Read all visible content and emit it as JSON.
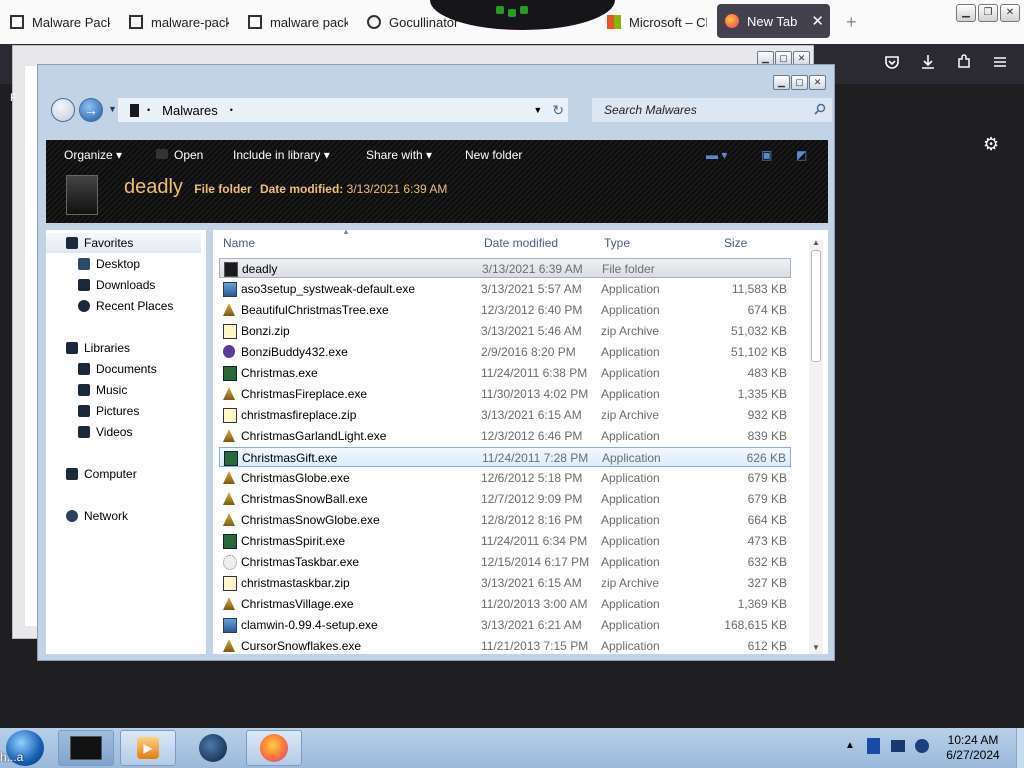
{
  "browser": {
    "tabs": [
      {
        "label": "Malware Pack",
        "favicon": "page-icon"
      },
      {
        "label": "malware-pack",
        "favicon": "page-icon"
      },
      {
        "label": "malware pack",
        "favicon": "page-icon"
      },
      {
        "label": "Gocullinator",
        "favicon": "github-icon"
      },
      {
        "label": "Microsoft – Cl",
        "favicon": "microsoft-icon"
      }
    ],
    "active_tab": {
      "label": "New Tab",
      "close": "✕"
    },
    "new_tab": "+",
    "toolbar_icons": [
      "pocket-icon",
      "download-icon",
      "extensions-icon",
      "menu-icon"
    ],
    "bg_window_letter": "F"
  },
  "explorer": {
    "nav_back": "◀",
    "nav_forward": "→",
    "address": "Malwares",
    "search_placeholder": "Search Malwares",
    "toolbar": {
      "organize": "Organize",
      "open": "Open",
      "include": "Include in library",
      "share": "Share with",
      "new_folder": "New folder"
    },
    "details": {
      "name": "deadly",
      "type": "File folder",
      "modified_label": "Date modified:",
      "modified_value": "3/13/2021 6:39 AM"
    },
    "nav": {
      "favorites": "Favorites",
      "desktop": "Desktop",
      "downloads": "Downloads",
      "recent": "Recent Places",
      "libraries": "Libraries",
      "documents": "Documents",
      "music": "Music",
      "pictures": "Pictures",
      "videos": "Videos",
      "computer": "Computer",
      "network": "Network"
    },
    "columns": {
      "name": "Name",
      "date": "Date modified",
      "type": "Type",
      "size": "Size"
    },
    "files": [
      {
        "name": "deadly",
        "date": "3/13/2021 6:39 AM",
        "type": "File folder",
        "size": "",
        "icon": "folder-icon"
      },
      {
        "name": "aso3setup_systweak-default.exe",
        "date": "3/13/2021 5:57 AM",
        "type": "Application",
        "size": "11,583 KB",
        "icon": "installer-icon"
      },
      {
        "name": "BeautifulChristmasTree.exe",
        "date": "12/3/2012 6:40 PM",
        "type": "Application",
        "size": "674 KB",
        "icon": "tree-icon"
      },
      {
        "name": "Bonzi.zip",
        "date": "3/13/2021 5:46 AM",
        "type": "zip Archive",
        "size": "51,032 KB",
        "icon": "zip-icon"
      },
      {
        "name": "BonziBuddy432.exe",
        "date": "2/9/2016 8:20 PM",
        "type": "Application",
        "size": "51,102 KB",
        "icon": "bonzi-icon"
      },
      {
        "name": "Christmas.exe",
        "date": "11/24/2011 6:38 PM",
        "type": "Application",
        "size": "483 KB",
        "icon": "christmas-icon"
      },
      {
        "name": "ChristmasFireplace.exe",
        "date": "11/30/2013 4:02 PM",
        "type": "Application",
        "size": "1,335 KB",
        "icon": "tree-icon"
      },
      {
        "name": "christmasfireplace.zip",
        "date": "3/13/2021 6:15 AM",
        "type": "zip Archive",
        "size": "932 KB",
        "icon": "zip-icon"
      },
      {
        "name": "ChristmasGarlandLight.exe",
        "date": "12/3/2012 6:46 PM",
        "type": "Application",
        "size": "839 KB",
        "icon": "tree-icon"
      },
      {
        "name": "ChristmasGift.exe",
        "date": "11/24/2011 7:28 PM",
        "type": "Application",
        "size": "626 KB",
        "icon": "christmas-icon"
      },
      {
        "name": "ChristmasGlobe.exe",
        "date": "12/6/2012 5:18 PM",
        "type": "Application",
        "size": "679 KB",
        "icon": "tree-icon"
      },
      {
        "name": "ChristmasSnowBall.exe",
        "date": "12/7/2012 9:09 PM",
        "type": "Application",
        "size": "679 KB",
        "icon": "tree-icon"
      },
      {
        "name": "ChristmasSnowGlobe.exe",
        "date": "12/8/2012 8:16 PM",
        "type": "Application",
        "size": "664 KB",
        "icon": "tree-icon"
      },
      {
        "name": "ChristmasSpirit.exe",
        "date": "11/24/2011 6:34 PM",
        "type": "Application",
        "size": "473 KB",
        "icon": "christmas-icon"
      },
      {
        "name": "ChristmasTaskbar.exe",
        "date": "12/15/2014 6:17 PM",
        "type": "Application",
        "size": "632 KB",
        "icon": "generic-exe-icon"
      },
      {
        "name": "christmastaskbar.zip",
        "date": "3/13/2021 6:15 AM",
        "type": "zip Archive",
        "size": "327 KB",
        "icon": "zip-icon"
      },
      {
        "name": "ChristmasVillage.exe",
        "date": "11/20/2013 3:00 AM",
        "type": "Application",
        "size": "1,369 KB",
        "icon": "tree-icon"
      },
      {
        "name": "clamwin-0.99.4-setup.exe",
        "date": "3/13/2021 6:21 AM",
        "type": "Application",
        "size": "168,615 KB",
        "icon": "installer-icon"
      },
      {
        "name": "CursorSnowflakes.exe",
        "date": "11/21/2013 7:15 PM",
        "type": "Application",
        "size": "612 KB",
        "icon": "tree-icon"
      }
    ],
    "selected_index": 0,
    "hover_index": 9
  },
  "taskbar": {
    "start_label": "h...a",
    "time": "10:24 AM",
    "date": "6/27/2024"
  },
  "colors": {
    "accent": "#42414d",
    "toolbar_text": "#f0c070"
  }
}
